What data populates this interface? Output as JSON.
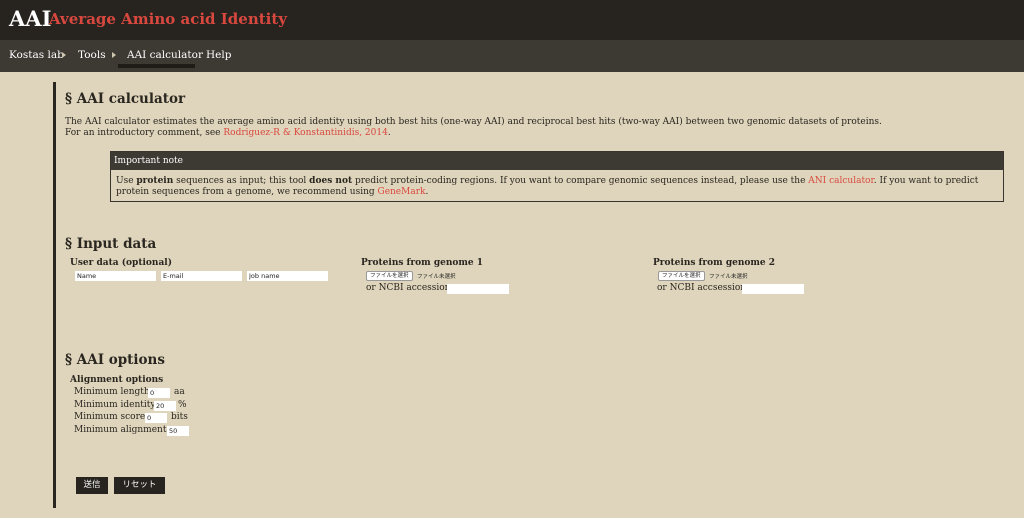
{
  "header": {
    "abbr": "AAI",
    "title": "Average Amino acid Identity"
  },
  "nav": {
    "items": [
      "Kostas lab",
      "Tools",
      "AAI calculator",
      "Help"
    ]
  },
  "intro": {
    "heading": "§ AAI calculator",
    "line1": "The AAI calculator estimates the average amino acid identity using both best hits (one-way AAI) and reciprocal best hits (two-way AAI) between two genomic datasets of proteins.",
    "line2_prefix": "For an introductory comment, see ",
    "line2_link": "Rodriguez-R & Konstantinidis, 2014",
    "line2_suffix": "."
  },
  "note": {
    "heading": "Important note",
    "t1": "Use ",
    "b1": "protein",
    "t2": " sequences as input; this tool ",
    "b2": "does not",
    "t3": " predict protein-coding regions. If you want to compare genomic sequences instead, please use the ",
    "link1": "ANI calculator",
    "t4": ". If you want to predict protein sequences from a genome, we recommend using ",
    "link2": "GeneMark",
    "t5": "."
  },
  "input": {
    "heading": "§ Input data",
    "user_heading": "User data (optional)",
    "name_placeholder": "Name",
    "email_placeholder": "E-mail",
    "job_placeholder": "Job name",
    "genome1_heading": "Proteins from genome 1",
    "genome2_heading": "Proteins from genome 2",
    "choose_file": "ファイルを選択",
    "no_file": "ファイル未選択",
    "ncbi1_label": "or NCBI accession:",
    "ncbi2_label": "or NCBI accsession:"
  },
  "options": {
    "heading": "§ AAI options",
    "align_heading": "Alignment options",
    "min_length_label": "Minimum length:",
    "min_length_value": "0",
    "min_length_unit": "aa",
    "min_identity_label": "Minimum identity:",
    "min_identity_value": "20",
    "min_identity_unit": "%",
    "min_score_label": "Minimum score:",
    "min_score_value": "0",
    "min_score_unit": "bits",
    "min_align_label": "Minimum alignments:",
    "min_align_value": "50"
  },
  "buttons": {
    "submit": "送信",
    "reset": "リセット"
  }
}
